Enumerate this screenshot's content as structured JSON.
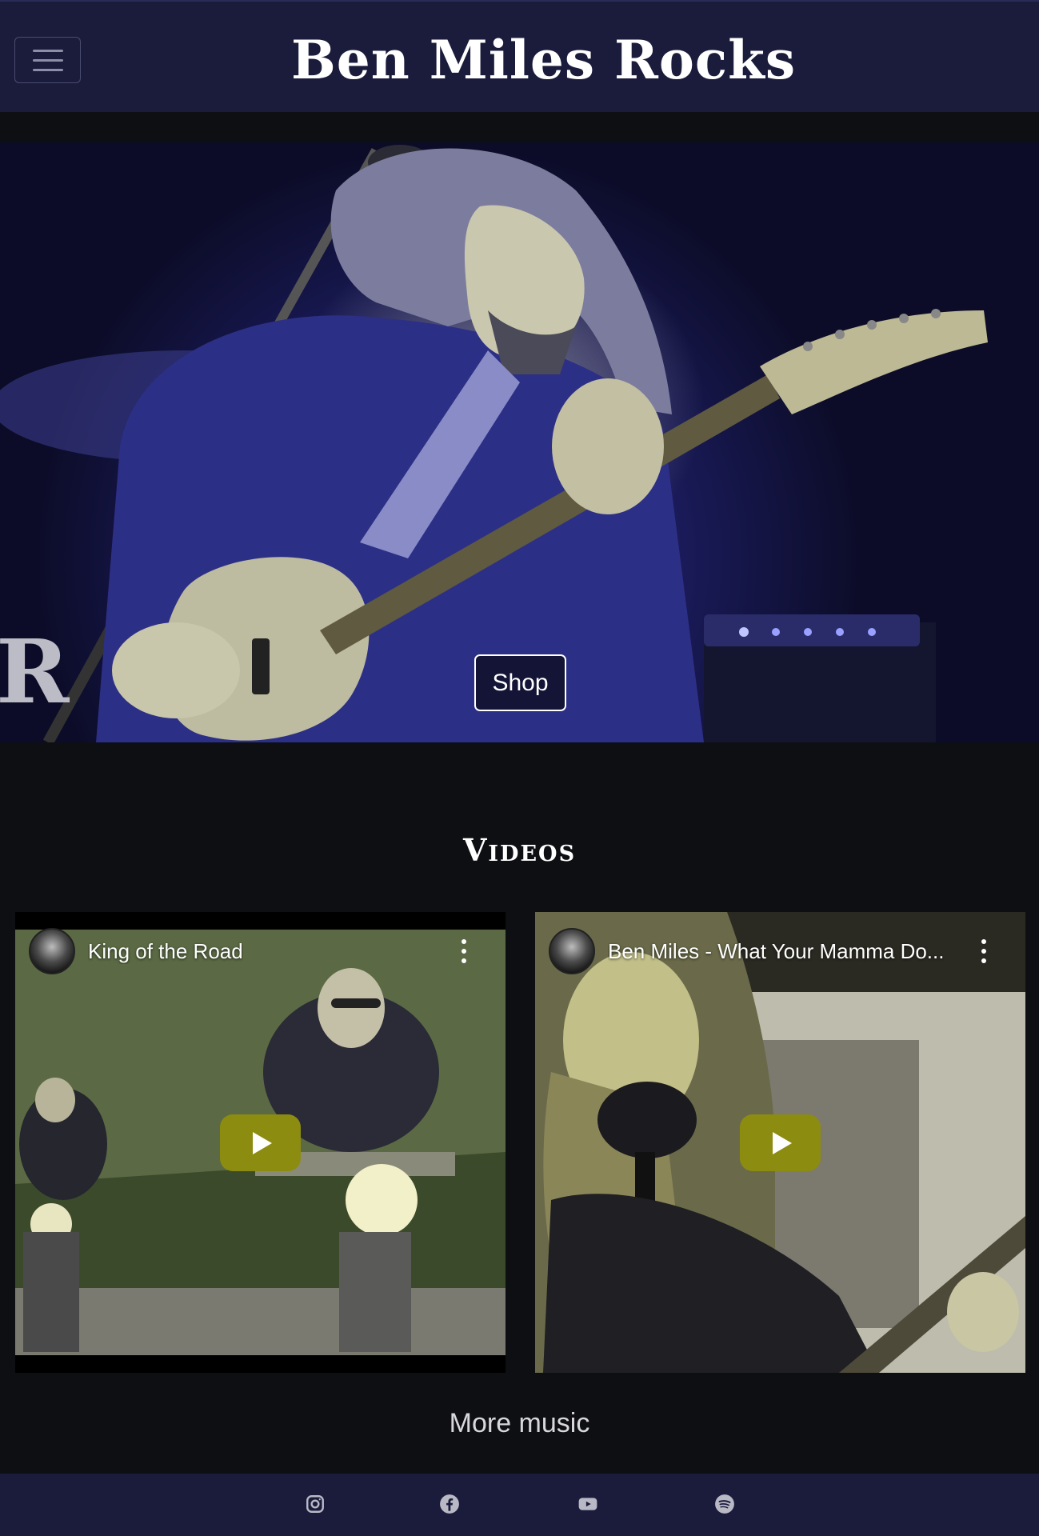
{
  "header": {
    "site_title": "Ben Miles Rocks",
    "menu_icon": "hamburger-menu-icon"
  },
  "hero": {
    "shop_label": "Shop"
  },
  "videos": {
    "heading": "Videos",
    "items": [
      {
        "title": "King of the Road"
      },
      {
        "title": "Ben Miles - What Your Mamma Do..."
      }
    ]
  },
  "more_music": "More music",
  "footer": {
    "social": [
      "instagram-icon",
      "facebook-icon",
      "youtube-icon",
      "spotify-icon"
    ]
  },
  "colors": {
    "header_bg": "#1b1c3c",
    "page_bg": "#0e0f13",
    "play_button": "#8c8c10"
  }
}
